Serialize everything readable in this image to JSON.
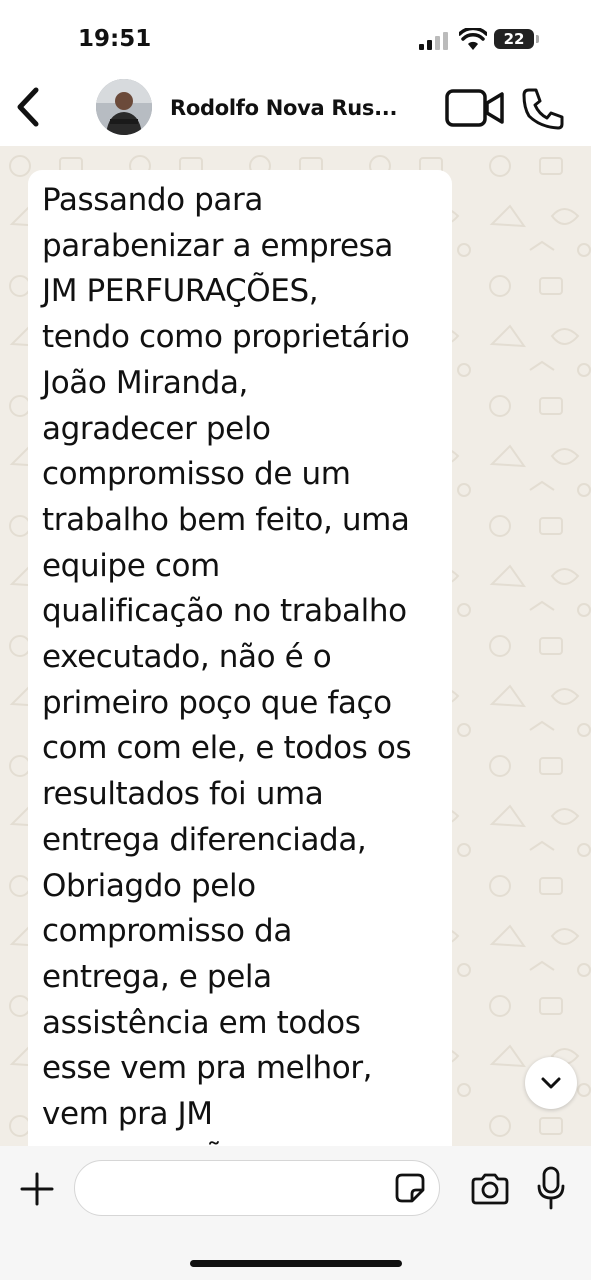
{
  "status_bar": {
    "time": "19:51",
    "battery": "22",
    "icons": [
      "signal-icon",
      "wifi-icon",
      "battery-icon"
    ]
  },
  "header": {
    "contact_name": "Rodolfo Nova Rus...",
    "icons": [
      "back-arrow-icon",
      "video-call-icon",
      "phone-call-icon"
    ]
  },
  "message": {
    "text": "Passando para\nparabenizar a empresa\nJM PERFURAÇÕES,\ntendo como proprietário\nJoão Miranda,\nagradecer pelo\ncompromisso de um\ntrabalho bem feito, uma\nequipe com\nqualificação no trabalho\nexecutado, não é o\nprimeiro poço  que faço\ncom com ele, e todos os\nresultados foi uma\nentrega diferenciada,\nObriagdo pelo\ncompromisso da\nentrega, e pela\nassistência em todos\nesse  vem pra melhor,\nvem pra JM\nPERFURAÇÕES"
  },
  "input_bar": {
    "value": "",
    "icons": [
      "plus-icon",
      "sticker-icon",
      "camera-icon",
      "microphone-icon"
    ]
  },
  "colors": {
    "chat_background": "#f1ede6",
    "bubble": "#ffffff",
    "input_bar": "#f6f6f6"
  }
}
